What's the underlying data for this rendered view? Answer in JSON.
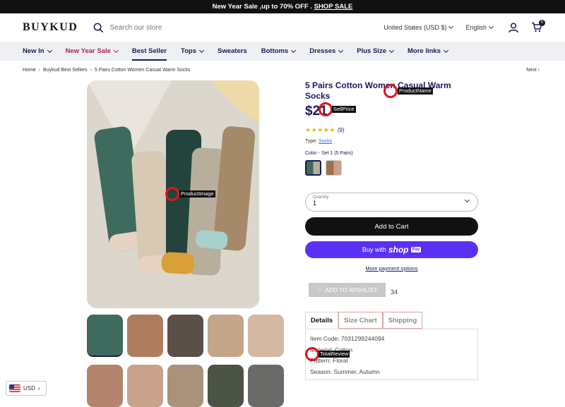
{
  "announcement": {
    "text": "New Year Sale ,up to 70% OFF . ",
    "link": "SHOP SALE"
  },
  "header": {
    "logo": "BUYKUD",
    "search_placeholder": "Search our store",
    "currency": "United States (USD $)",
    "language": "English",
    "cart_count": "0"
  },
  "nav": {
    "items": [
      {
        "label": "New In",
        "dropdown": true
      },
      {
        "label": "New Year Sale",
        "dropdown": true
      },
      {
        "label": "Best Seller",
        "dropdown": false
      },
      {
        "label": "Tops",
        "dropdown": true
      },
      {
        "label": "Sweaters",
        "dropdown": false
      },
      {
        "label": "Bottoms",
        "dropdown": true
      },
      {
        "label": "Dresses",
        "dropdown": true
      },
      {
        "label": "Plus Size",
        "dropdown": true
      },
      {
        "label": "More links",
        "dropdown": true
      }
    ]
  },
  "breadcrumb": {
    "items": [
      "Home",
      "Buykud Best Sellers",
      "5 Pairs Cotton Women Casual Warm Socks"
    ],
    "next": "Next"
  },
  "product": {
    "title": "5 Pairs Cotton Women Casual Warm Socks",
    "price": "$21.",
    "review_count": "(9)",
    "rating": 5,
    "type_label": "Type:",
    "type_value": "Socks",
    "color_label": "Color - Set 1 (5 Pairs)",
    "quantity_label": "Quantity",
    "quantity_value": "1",
    "add_to_cart": "Add to Cart",
    "buy_with": "Buy with",
    "shop": "shop",
    "pay": "Pay",
    "more_payment": "More payment options",
    "wishlist": "ADD TO WISHLIST",
    "wishlist_count": "34"
  },
  "tabs": {
    "labels": [
      "Details",
      "Size Chart",
      "Shipping"
    ],
    "details": [
      "Item Code: 7031299244094",
      "Material: Cotton",
      "Pattern: Floral",
      "Season: Summer, Autumn"
    ]
  },
  "currency_widget": {
    "label": "USD"
  },
  "annotations": {
    "product_name": "ProductName",
    "sell_price": "SellPrice",
    "product_image": "ProductImage",
    "total_review": "TotalReview"
  },
  "colors": {
    "brand_navy": "#1a1a5a",
    "sale_red": "#b0224a",
    "shop_pay": "#5a31f4",
    "marker_red": "#e0141b"
  }
}
